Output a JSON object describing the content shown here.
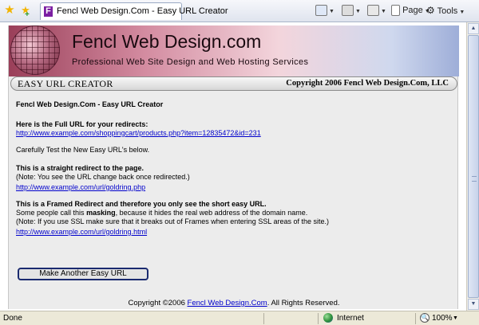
{
  "browser": {
    "tab_title": "Fencl Web Design.Com - Easy URL Creator",
    "tab_favicon_letter": "F",
    "toolbar": {
      "page_label": "Page",
      "tools_label": "Tools"
    },
    "icons": {
      "favorites": "star-icon",
      "add_favorite": "add-favorite-icon",
      "home": "home-icon",
      "feeds": "feed-icon",
      "print": "print-icon",
      "page": "page-icon",
      "tools": "gear-icon"
    }
  },
  "banner": {
    "brand": "Fencl Web Design.com",
    "tagline": "Professional Web Site Design and Web Hosting Services",
    "bar_left": "EASY URL CREATOR",
    "bar_right": "Copyright 2006 Fencl Web Design.Com, LLC"
  },
  "content": {
    "heading": "Fencl Web Design.Com - Easy URL Creator",
    "full_url_label": "Here is the Full URL for your redirects:",
    "full_url": "http://www.example.com/shoppingcart/products.php?item=12835472&id=231",
    "test_note": "Carefully Test the New Easy URL's below.",
    "straight_heading": "This is a straight redirect to the page.",
    "straight_note": "(Note: You see the URL change back once redirected.)",
    "straight_url": "http://www.example.com/url/goldring.php",
    "framed_heading": "This is a Framed Redirect and therefore you only see the short easy URL.",
    "framed_line1_pre": "Some people call this ",
    "framed_line1_bold": "masking",
    "framed_line1_post": ", because it hides the real web address of the domain name.",
    "framed_note": "(Note: If you use SSL make sure that it breaks out of Frames when entering SSL areas of the site.)",
    "framed_url": "http://www.example.com/url/goldring.html",
    "make_button": "Make Another Easy URL"
  },
  "footer": {
    "pre": "Copyright ©2006 ",
    "link": "Fencl Web Design.Com",
    "post": ". All Rights Reserved."
  },
  "status": {
    "left": "Done",
    "zone": "Internet",
    "zoom": "100%"
  },
  "colors": {
    "link": "#0000cc",
    "button_border": "#1a2a6f",
    "banner_left": "#9a3f59",
    "banner_right": "#9eaed8"
  }
}
